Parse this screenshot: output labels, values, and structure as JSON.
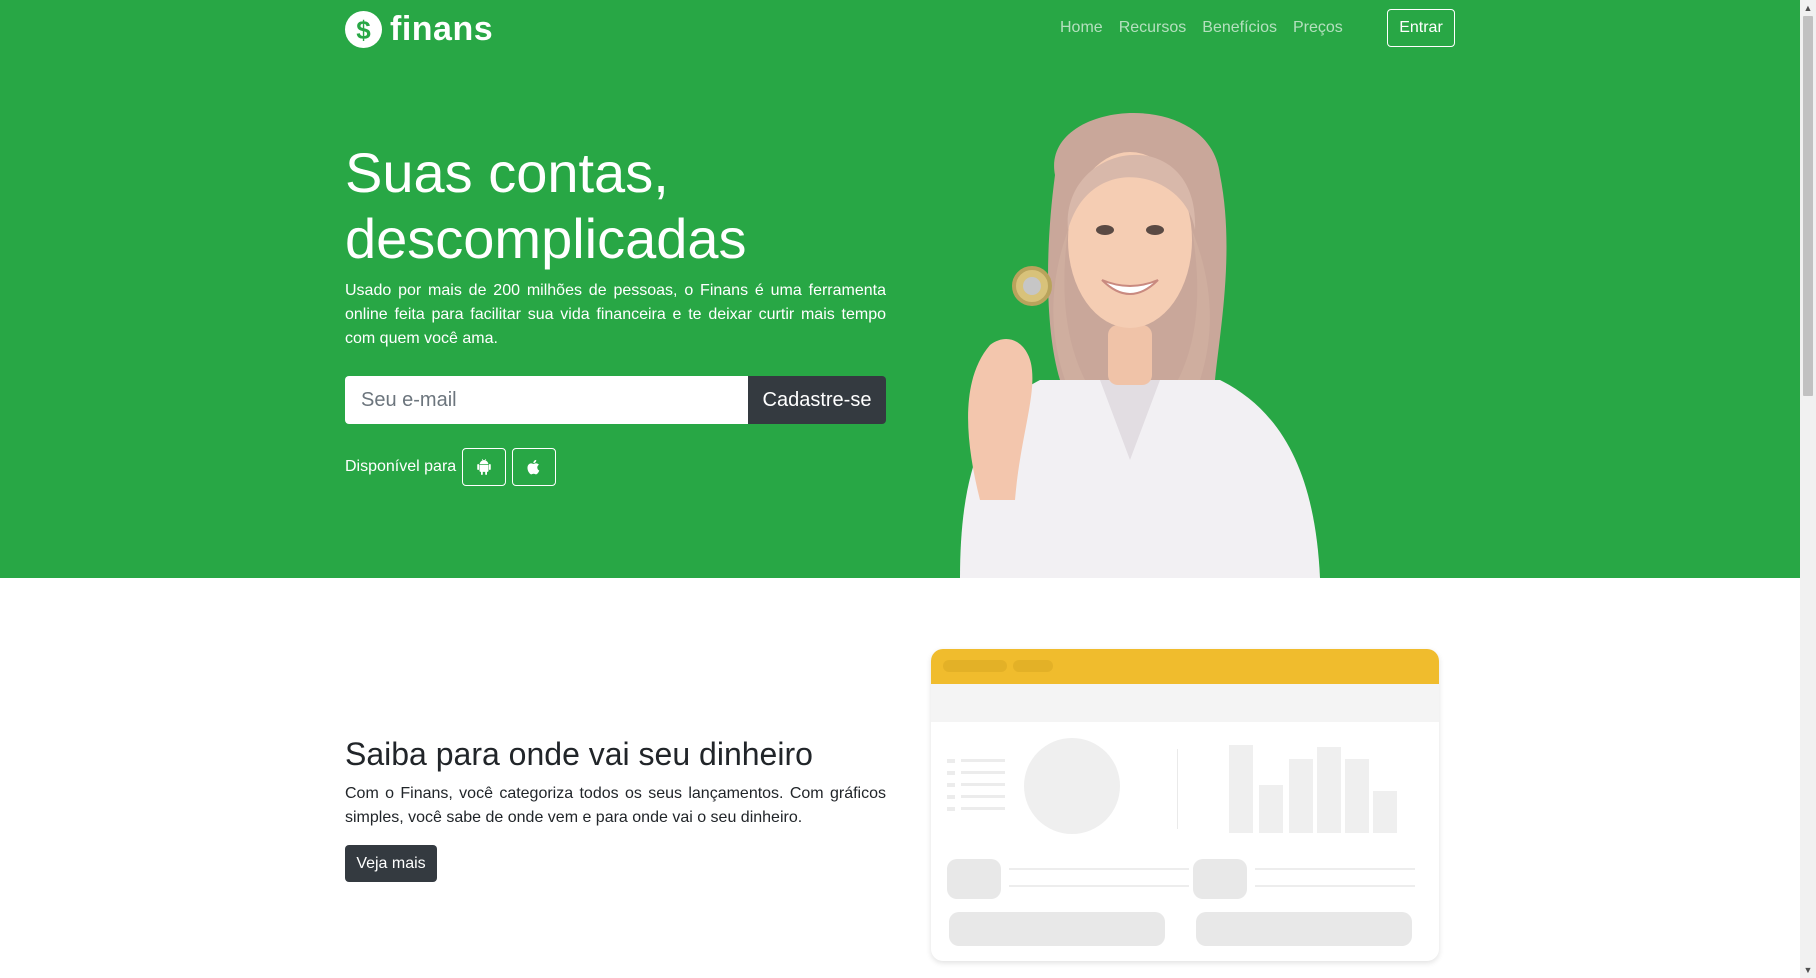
{
  "nav": {
    "brand_icon": "$",
    "brand": "finans",
    "links": [
      "Home",
      "Recursos",
      "Benefícios",
      "Preços"
    ],
    "cta": "Entrar"
  },
  "hero": {
    "title_line1": "Suas contas,",
    "title_line2": "descomplicadas",
    "lead": "Usado por mais de 200 milhões de pessoas, o Finans é uma ferramenta online feita para facilitar sua vida financeira e te deixar curtir mais tempo com quem você ama.",
    "email_placeholder": "Seu e-mail",
    "signup_button": "Cadastre-se",
    "available_label": "Disponível para",
    "stores": [
      "android-icon",
      "apple-icon"
    ]
  },
  "feature": {
    "title": "Saiba para onde vai seu dinheiro",
    "text": "Com o Finans, você categoriza todos os seus lançamentos. Com gráficos simples, você sabe de onde vem e para onde vai o seu dinheiro.",
    "button": "Veja mais"
  },
  "colors": {
    "brand_green": "#28a745",
    "dark": "#343a40",
    "mock_header": "#f0bc2d"
  }
}
